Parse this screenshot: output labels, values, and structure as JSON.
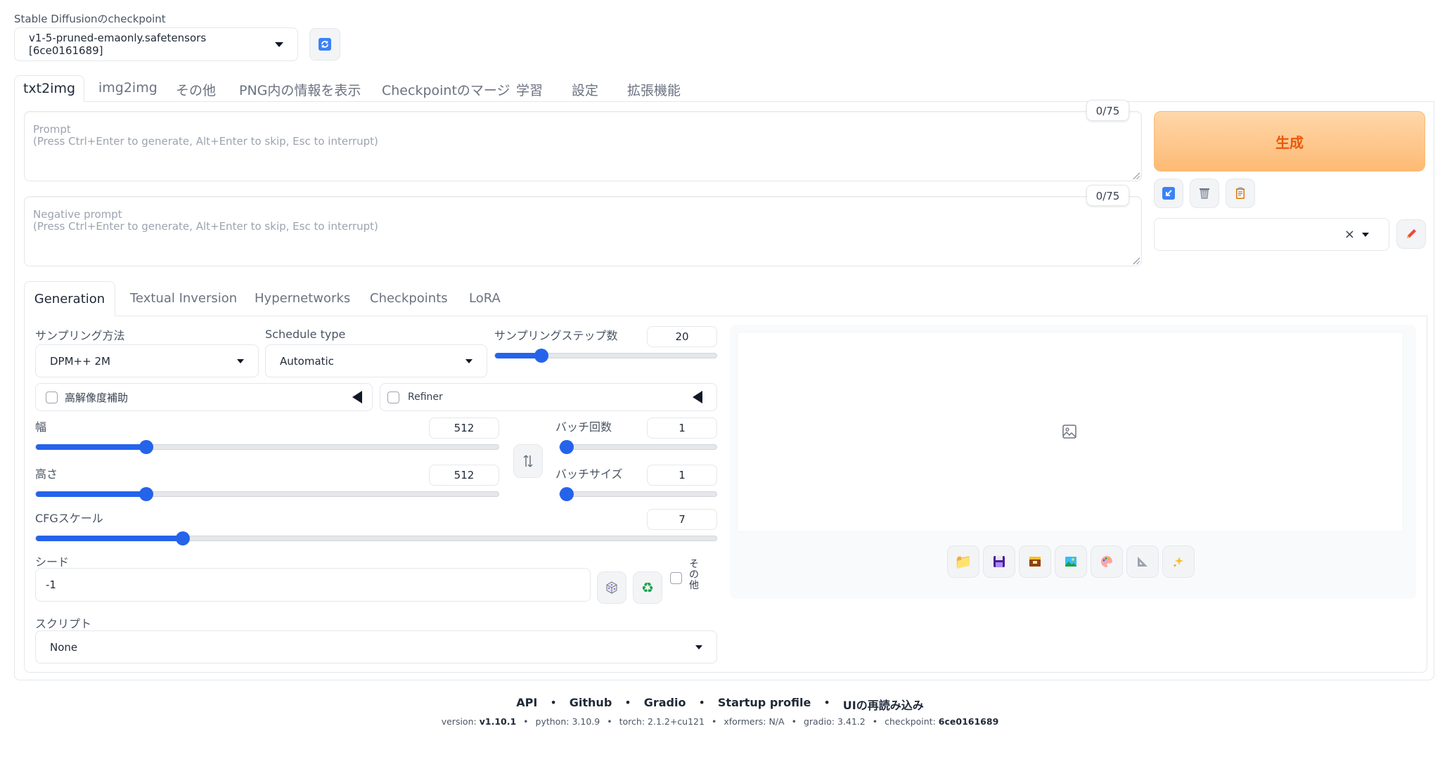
{
  "checkpoint": {
    "label": "Stable Diffusionのcheckpoint",
    "value": "v1-5-pruned-emaonly.safetensors [6ce0161689]",
    "refresh_icon": "refresh-icon"
  },
  "tabs": [
    {
      "label": "txt2img",
      "active": true
    },
    {
      "label": "img2img"
    },
    {
      "label": "その他"
    },
    {
      "label": "PNG内の情報を表示"
    },
    {
      "label": "Checkpointのマージ"
    },
    {
      "label": "学習"
    },
    {
      "label": "設定"
    },
    {
      "label": "拡張機能"
    }
  ],
  "prompt": {
    "placeholder": "Prompt\n(Press Ctrl+Enter to generate, Alt+Enter to skip, Esc to interrupt)",
    "counter": "0/75"
  },
  "negative_prompt": {
    "placeholder": "Negative prompt\n(Press Ctrl+Enter to generate, Alt+Enter to skip, Esc to interrupt)",
    "counter": "0/75"
  },
  "generate_button": "生成",
  "generate_color": "#f97316",
  "style_select": {
    "value": ""
  },
  "subtabs": [
    {
      "label": "Generation",
      "active": true
    },
    {
      "label": "Textual Inversion"
    },
    {
      "label": "Hypernetworks"
    },
    {
      "label": "Checkpoints"
    },
    {
      "label": "LoRA"
    }
  ],
  "sampling_method": {
    "label": "サンプリング方法",
    "value": "DPM++ 2M"
  },
  "schedule_type": {
    "label": "Schedule type",
    "value": "Automatic"
  },
  "sampling_steps": {
    "label": "サンプリングステップ数",
    "value": "20",
    "fraction": 0.19
  },
  "hires_fix": {
    "label": "高解像度補助"
  },
  "refiner": {
    "label": "Refiner"
  },
  "width": {
    "label": "幅",
    "value": "512",
    "fraction": 0.23
  },
  "height": {
    "label": "高さ",
    "value": "512",
    "fraction": 0.23
  },
  "batch_count": {
    "label": "バッチ回数",
    "value": "1",
    "fraction": 0.0
  },
  "batch_size": {
    "label": "バッチサイズ",
    "value": "1",
    "fraction": 0.0
  },
  "cfg_scale": {
    "label": "CFGスケール",
    "value": "7",
    "fraction": 0.21
  },
  "seed": {
    "label": "シード",
    "value": "-1",
    "extra_label": "その他"
  },
  "script": {
    "label": "スクリプト",
    "value": "None"
  },
  "accent_color": "#2563eb",
  "output_toolbar": [
    "folder-icon",
    "save-icon",
    "zip-icon",
    "image-icon",
    "palette-icon",
    "ruler-icon",
    "sparkle-icon"
  ],
  "footer": {
    "links": [
      "API",
      "Github",
      "Gradio",
      "Startup profile",
      "UIの再読み込み"
    ],
    "version": {
      "version_label": "version:",
      "version_value": "v1.10.1",
      "python_label": "python:",
      "python_value": "3.10.9",
      "torch_label": "torch:",
      "torch_value": "2.1.2+cu121",
      "xformers_label": "xformers:",
      "xformers_value": "N/A",
      "gradio_label": "gradio:",
      "gradio_value": "3.41.2",
      "checkpoint_label": "checkpoint:",
      "checkpoint_value": "6ce0161689"
    }
  }
}
